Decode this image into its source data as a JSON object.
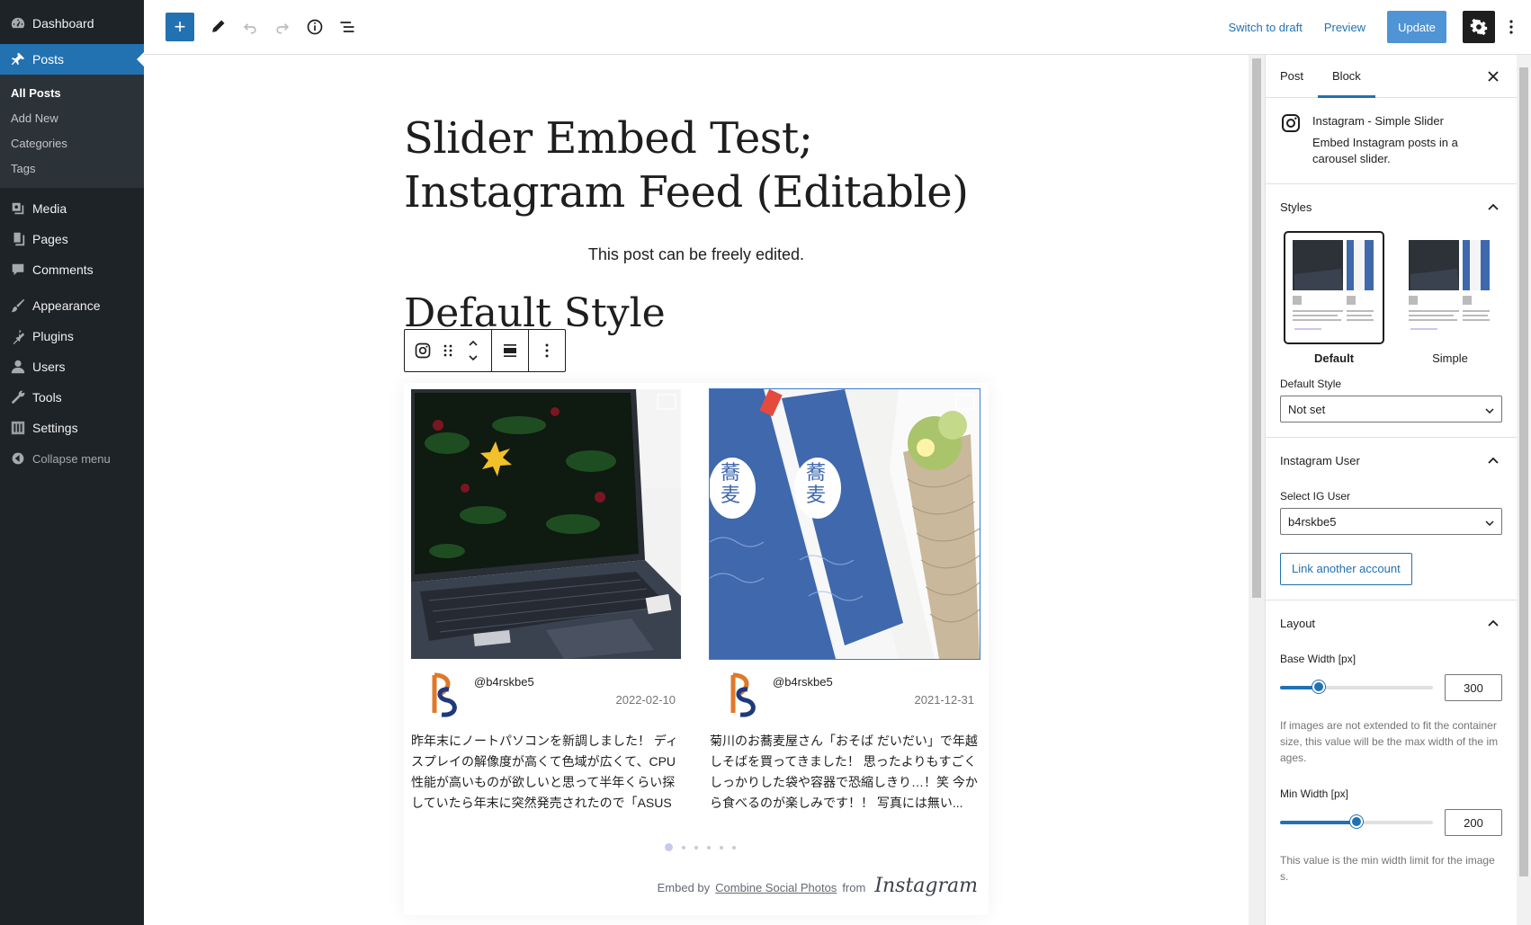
{
  "admin_menu": {
    "dashboard": "Dashboard",
    "posts": "Posts",
    "posts_submenu": [
      "All Posts",
      "Add New",
      "Categories",
      "Tags"
    ],
    "media": "Media",
    "pages": "Pages",
    "comments": "Comments",
    "appearance": "Appearance",
    "plugins": "Plugins",
    "users": "Users",
    "tools": "Tools",
    "settings": "Settings",
    "collapse": "Collapse menu"
  },
  "header": {
    "switch_to_draft": "Switch to draft",
    "preview": "Preview",
    "update": "Update"
  },
  "post": {
    "title": "Slider Embed Test; Instagram Feed (Editable)",
    "paragraph": "This post can be freely edited.",
    "heading": "Default Style"
  },
  "slider": {
    "cards": [
      {
        "username": "@b4rskbe5",
        "date": "2022-02-10",
        "caption": "昨年末にノートパソコンを新調しました！ ディスプレイの解像度が高くて色域が広くて、CPU性能が高いものが欲しいと思って半年くらい探していたら年末に突然発売されたので「ASUS ..."
      },
      {
        "username": "@b4rskbe5",
        "date": "2021-12-31",
        "caption": "菊川のお蕎麦屋さん「おそば だいだい」で年越しそばを買ってきました！ 思ったよりもすごくしっかりした袋や容器で恐縮しきり…！笑 今から食べるのが楽しみです！！ 写真には無い..."
      }
    ],
    "credit_embed": "Embed by",
    "credit_link": "Combine Social Photos",
    "credit_from": "from",
    "credit_brand": "Instagram"
  },
  "sidebar": {
    "tab_post": "Post",
    "tab_block": "Block",
    "block_title": "Instagram - Simple Slider",
    "block_desc": "Embed Instagram posts in a carousel slider.",
    "styles_title": "Styles",
    "style_default": "Default",
    "style_simple": "Simple",
    "default_style_label": "Default Style",
    "default_style_value": "Not set",
    "ig_user_title": "Instagram User",
    "select_user_label": "Select IG User",
    "select_user_value": "b4rskbe5",
    "link_account": "Link another account",
    "layout_title": "Layout",
    "base_width_label": "Base Width [px]",
    "base_width_value": "300",
    "base_width_help": "If images are not extended to fit the container size, this value will be the max width of the images.",
    "min_width_label": "Min Width [px]",
    "min_width_value": "200",
    "min_width_help": "This value is the min width limit for the images."
  },
  "slider_levels": {
    "base_width_fraction": 0.25,
    "min_width_fraction": 0.5
  },
  "colors": {
    "admin_bg": "#1d2327",
    "accent": "#2271b1",
    "update_btn": "#4f94d4"
  }
}
